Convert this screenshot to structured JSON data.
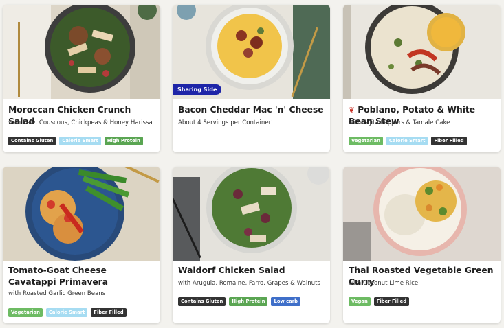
{
  "colors": {
    "gluten": "#333333",
    "calorie_smart": "#a6dcf2",
    "high_protein": "#5aa552",
    "vegetarian": "#6dbb63",
    "vegan": "#6dbb63",
    "fiber_filled": "#333333",
    "low_carb": "#3f6fc9",
    "sharing_side": "#1e25a8"
  },
  "meals": [
    {
      "title": "Moroccan Chicken Crunch Salad",
      "subtitle": "with Kale, Couscous, Chickpeas & Honey Harissa",
      "badges": [
        "Contains Gluten",
        "Calorie Smart",
        "High Protein"
      ]
    },
    {
      "title": "Bacon Cheddar Mac 'n' Cheese",
      "subtitle": "About 4 Servings per Container",
      "tag": "Sharing Side",
      "badges": []
    },
    {
      "title": "Poblano, Potato & White Bean Stew",
      "title_icon": "chili-pepper-icon",
      "subtitle": "with Fajita Peppers & Tamale Cake",
      "badges": [
        "Vegetarian",
        "Calorie Smart",
        "Fiber Filled"
      ]
    },
    {
      "title": "Tomato-Goat Cheese Cavatappi Primavera",
      "subtitle": "with Roasted Garlic Green Beans",
      "badges": [
        "Vegetarian",
        "Calorie Smart",
        "Fiber Filled"
      ]
    },
    {
      "title": "Waldorf Chicken Salad",
      "subtitle": "with Arugula, Romaine, Farro, Grapes & Walnuts",
      "badges": [
        "Contains Gluten",
        "High Protein",
        "Low carb"
      ]
    },
    {
      "title": "Thai Roasted Vegetable Green Curry",
      "subtitle": "with Coconut Lime Rice",
      "badges": [
        "Vegan",
        "Fiber Filled"
      ]
    }
  ]
}
